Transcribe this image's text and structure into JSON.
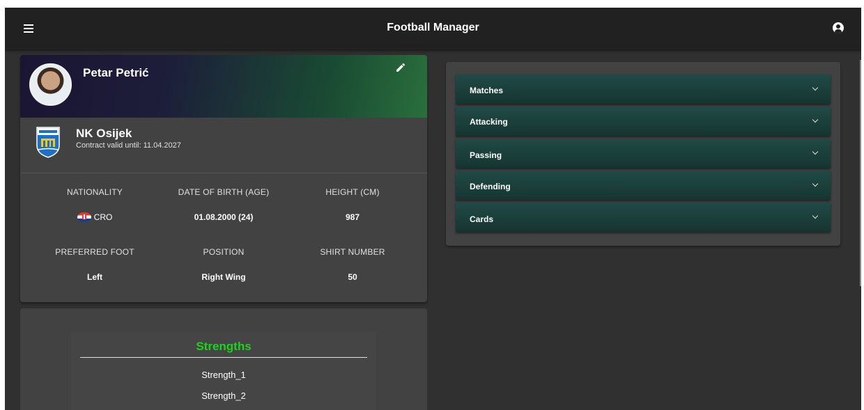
{
  "app": {
    "title": "Football Manager"
  },
  "icons": {
    "menu": "menu-icon",
    "account": "account-circle-icon",
    "edit": "pencil-icon",
    "club": "club-crest-icon",
    "flag": "croatia-flag-icon",
    "expand": "chevron-down-icon"
  },
  "player": {
    "name": "Petar Petrić",
    "club": "NK Osijek",
    "contract": "Contract valid until: 11.04.2027",
    "info": [
      {
        "label": "NATIONALITY",
        "value": "CRO"
      },
      {
        "label": "DATE OF BIRTH (AGE)",
        "value": "01.08.2000 (24)"
      },
      {
        "label": "HEIGHT (CM)",
        "value": "987"
      },
      {
        "label": "PREFERRED FOOT",
        "value": "Left"
      },
      {
        "label": "POSITION",
        "value": "Right Wing"
      },
      {
        "label": "SHIRT NUMBER",
        "value": "50"
      }
    ]
  },
  "strengths": {
    "title": "Strengths",
    "items": [
      "Strength_1",
      "Strength_2"
    ]
  },
  "stats_panels": [
    "Matches",
    "Attacking",
    "Passing",
    "Defending",
    "Cards"
  ],
  "colors": {
    "toolbar": "#212121",
    "background": "#303030",
    "card": "#424242",
    "accent_green": "#20d020",
    "panel": "#1b3f3b"
  }
}
